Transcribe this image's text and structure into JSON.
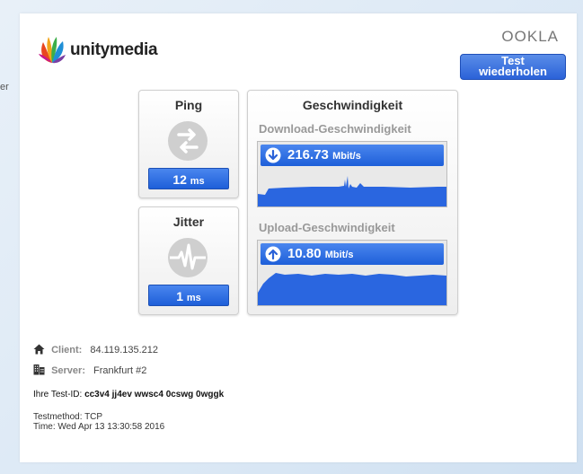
{
  "edge_fragment": "er",
  "brand": {
    "name": "unitymedia",
    "partner": "OOKLA"
  },
  "retest_button": {
    "line1": "Test",
    "line2": "wiederholen"
  },
  "ping": {
    "title": "Ping",
    "value": "12",
    "unit": "ms"
  },
  "jitter": {
    "title": "Jitter",
    "value": "1",
    "unit": "ms"
  },
  "speed": {
    "title": "Geschwindigkeit",
    "download": {
      "label": "Download-Geschwindigkeit",
      "value": "216.73",
      "unit": "Mbit/s"
    },
    "upload": {
      "label": "Upload-Geschwindigkeit",
      "value": "10.80",
      "unit": "Mbit/s"
    }
  },
  "client": {
    "label": "Client:",
    "value": "84.119.135.212"
  },
  "server": {
    "label": "Server:",
    "value": "Frankfurt #2"
  },
  "test_id": {
    "label": "Ihre Test-ID:",
    "value": "cc3v4 jj4ev wwsc4 0cswg 0wggk"
  },
  "test_method": "Testmethod: TCP",
  "test_time": "Time: Wed Apr 13 13:30:58 2016",
  "colors": {
    "accent": "#2b62d8",
    "graph_fill": "#2a66e0",
    "icon_gray": "#cfcfcf"
  },
  "icons": [
    "unitymedia-logo-icon",
    "ping-arrows-icon",
    "jitter-wave-icon",
    "download-arrow-icon",
    "upload-arrow-icon",
    "home-icon",
    "server-building-icon"
  ]
}
